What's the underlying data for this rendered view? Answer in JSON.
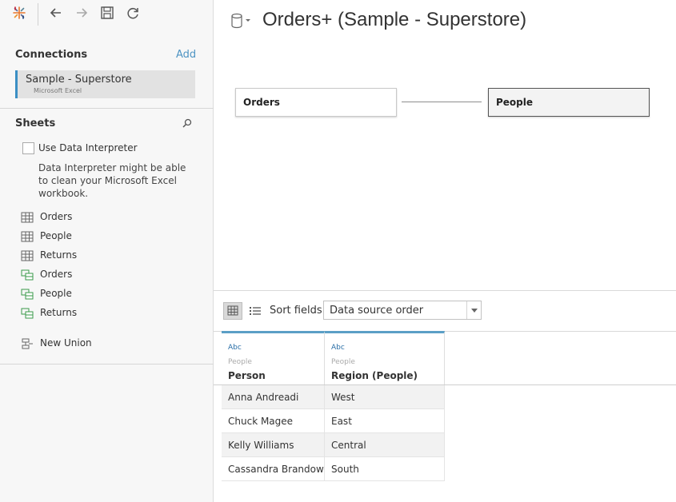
{
  "toolbar": {
    "icons": [
      "tableau-logo-icon",
      "back-icon",
      "forward-icon",
      "save-icon",
      "refresh-icon"
    ]
  },
  "connections": {
    "title": "Connections",
    "add_label": "Add",
    "items": [
      {
        "name": "Sample - Superstore",
        "type": "Microsoft Excel"
      }
    ]
  },
  "sheets": {
    "title": "Sheets",
    "interpreter_label": "Use Data Interpreter",
    "interpreter_checked": false,
    "interpreter_help": "Data Interpreter might be able to clean your Microsoft Excel workbook.",
    "items": [
      {
        "label": "Orders",
        "icon": "table-icon"
      },
      {
        "label": "People",
        "icon": "table-icon"
      },
      {
        "label": "Returns",
        "icon": "table-icon"
      },
      {
        "label": "Orders",
        "icon": "named-range-icon"
      },
      {
        "label": "People",
        "icon": "named-range-icon"
      },
      {
        "label": "Returns",
        "icon": "named-range-icon"
      }
    ],
    "new_union_label": "New Union"
  },
  "datasource": {
    "title": "Orders+ (Sample - Superstore)"
  },
  "canvas": {
    "left_table": "Orders",
    "right_table": "People"
  },
  "grid": {
    "sort_label": "Sort fields",
    "sort_value": "Data source order",
    "columns": [
      {
        "type": "Abc",
        "source": "People",
        "name": "Person"
      },
      {
        "type": "Abc",
        "source": "People",
        "name": "Region (People)"
      }
    ],
    "rows": [
      [
        "Anna Andreadi",
        "West"
      ],
      [
        "Chuck Magee",
        "East"
      ],
      [
        "Kelly Williams",
        "Central"
      ],
      [
        "Cassandra Brandow",
        "South"
      ]
    ]
  },
  "colors": {
    "accent": "#4e94c3",
    "column_header_top": "#5b9fc6",
    "named_range_green": "#3a9a4a"
  }
}
